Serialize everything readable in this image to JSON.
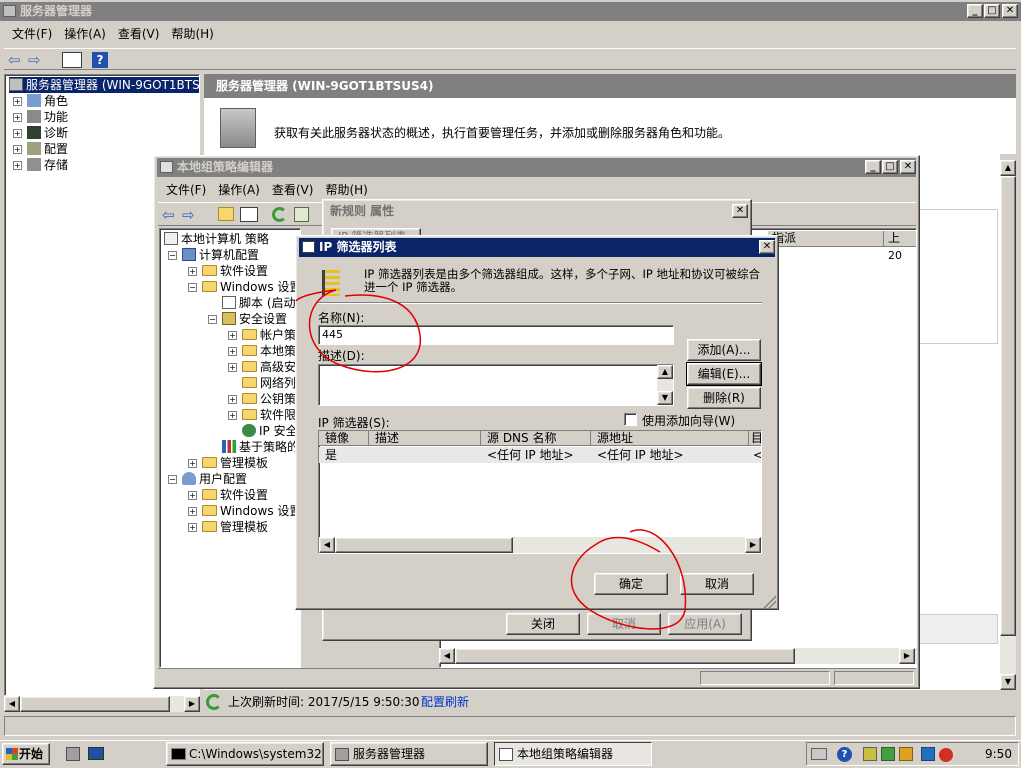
{
  "server_manager": {
    "title": "服务器管理器",
    "menu": [
      "文件(F)",
      "操作(A)",
      "查看(V)",
      "帮助(H)"
    ],
    "tree_root": "服务器管理器 (WIN-9GOT1BTSUS",
    "tree_items": [
      "角色",
      "功能",
      "诊断",
      "配置",
      "存储"
    ],
    "header_title": "服务器管理器 (WIN-9GOT1BTSUS4)",
    "description": "获取有关此服务器状态的概述，执行首要管理任务，并添加或删除服务器角色和功能。",
    "status_refresh": "上次刷新时间: 2017/5/15 9:50:30",
    "refresh_link": "配置刷新"
  },
  "gpo_editor": {
    "title": "本地组策略编辑器",
    "menu": [
      "文件(F)",
      "操作(A)",
      "查看(V)",
      "帮助(H)"
    ],
    "tree": {
      "root": "本地计算机 策略",
      "computer_config": "计算机配置",
      "software_settings": "软件设置",
      "windows_settings": "Windows 设置",
      "scripts": "脚本 (启动",
      "security_settings": "安全设置",
      "account_policies": "帐户策",
      "local_policies": "本地策",
      "advanced": "高级安",
      "network_list": "网络列",
      "public_key": "公钥策",
      "software_restriction": "软件限",
      "ip_security": "IP 安全",
      "policy_based_qos": "基于策略的",
      "admin_templates": "管理模板",
      "user_config": "用户配置",
      "user_software_settings": "软件设置",
      "user_windows_settings": "Windows 设置",
      "user_admin_templates": "管理模板"
    },
    "right_column_header": "指派",
    "right_column_header2": "上",
    "right_column_value": "20"
  },
  "rule_props": {
    "title": "新规则 属性",
    "tab_partial": "IP 筛选器列表",
    "close_label": "关闭",
    "cancel_label": "取消",
    "apply_label": "应用(A)"
  },
  "ip_filter_dialog": {
    "title": "IP 筛选器列表",
    "intro": "IP 筛选器列表是由多个筛选器组成。这样，多个子网、IP 地址和协议可被综合进一个 IP 筛选器。",
    "name_label": "名称(N):",
    "name_value": "445",
    "desc_label": "描述(D):",
    "desc_value": "",
    "add_button": "添加(A)...",
    "edit_button": "编辑(E)...",
    "remove_button": "删除(R)",
    "filters_label": "IP 筛选器(S):",
    "use_wizard_label": "使用添加向导(W)",
    "use_wizard_checked": false,
    "columns": [
      "镜像",
      "描述",
      "源 DNS 名称",
      "源地址",
      "目"
    ],
    "rows": [
      {
        "mirror": "是",
        "description": "",
        "src_dns": "<任何 IP 地址>",
        "src_addr": "<任何 IP 地址>",
        "dst": "<"
      }
    ],
    "ok_button": "确定",
    "cancel_button": "取消"
  },
  "taskbar": {
    "start": "开始",
    "items": [
      "C:\\Windows\\system32...",
      "服务器管理器",
      "本地组策略编辑器"
    ],
    "clock": "9:50"
  },
  "colors": {
    "active_title": "#0a246a",
    "annotation": "#e00000",
    "face": "#d4d0c8"
  }
}
